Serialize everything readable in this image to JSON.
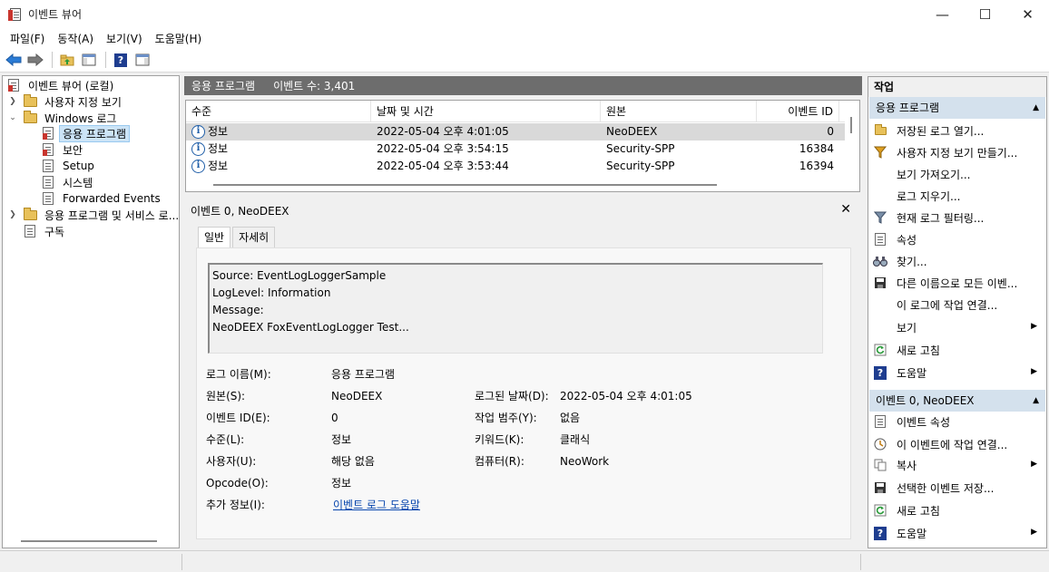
{
  "window": {
    "title": "이벤트 뷰어",
    "minimize": "—",
    "maximize": "☐",
    "close": "✕"
  },
  "menu": [
    "파일(F)",
    "동작(A)",
    "보기(V)",
    "도움말(H)"
  ],
  "tree": {
    "root": "이벤트 뷰어 (로컬)",
    "custom_views": "사용자 지정 보기",
    "windows_logs": "Windows 로그",
    "logs": [
      "응용 프로그램",
      "보안",
      "Setup",
      "시스템",
      "Forwarded Events"
    ],
    "app_services": "응용 프로그램 및 서비스 로...",
    "subscriptions": "구독"
  },
  "list": {
    "header_title": "응용 프로그램",
    "event_count": "이벤트 수: 3,401",
    "columns": [
      "수준",
      "날짜 및 시간",
      "원본",
      "이벤트 ID"
    ],
    "rows": [
      {
        "level": "정보",
        "datetime": "2022-05-04 오후 4:01:05",
        "source": "NeoDEEX",
        "id": "0"
      },
      {
        "level": "정보",
        "datetime": "2022-05-04 오후 3:54:15",
        "source": "Security-SPP",
        "id": "16384"
      },
      {
        "level": "정보",
        "datetime": "2022-05-04 오후 3:53:44",
        "source": "Security-SPP",
        "id": "16394"
      }
    ]
  },
  "detail": {
    "title": "이벤트 0, NeoDEEX",
    "close": "✕",
    "tabs": [
      "일반",
      "자세히"
    ],
    "message_lines": [
      "Source: EventLogLoggerSample",
      "LogLevel: Information",
      "Message:",
      "NeoDEEX FoxEventLogLogger Test..."
    ],
    "labels": {
      "log_name": "로그 이름(M):",
      "source": "원본(S):",
      "event_id": "이벤트 ID(E):",
      "level": "수준(L):",
      "user": "사용자(U):",
      "opcode": "Opcode(O):",
      "more_info": "추가 정보(I):",
      "logged": "로그된 날짜(D):",
      "task_category": "작업 범주(Y):",
      "keywords": "키워드(K):",
      "computer": "컴퓨터(R):"
    },
    "values": {
      "log_name": "응용 프로그램",
      "source": "NeoDEEX",
      "event_id": "0",
      "level": "정보",
      "user": "해당 없음",
      "opcode": "정보",
      "more_info": "이벤트 로그 도움말",
      "logged": "2022-05-04 오후 4:01:05",
      "task_category": "없음",
      "keywords": "클래식",
      "computer": "NeoWork"
    }
  },
  "actions": {
    "title": "작업",
    "section1": "응용 프로그램",
    "items1": [
      {
        "label": "저장된 로그 열기...",
        "icon": "folder-open-icon"
      },
      {
        "label": "사용자 지정 보기 만들기...",
        "icon": "filter-icon"
      },
      {
        "label": "보기 가져오기...",
        "icon": ""
      },
      {
        "label": "로그 지우기...",
        "icon": ""
      },
      {
        "label": "현재 로그 필터링...",
        "icon": "filter-icon"
      },
      {
        "label": "속성",
        "icon": "properties-icon"
      },
      {
        "label": "찾기...",
        "icon": "binoculars-icon"
      },
      {
        "label": "다른 이름으로 모든 이벤...",
        "icon": "save-icon"
      },
      {
        "label": "이 로그에 작업 연결...",
        "icon": ""
      },
      {
        "label": "보기",
        "icon": "",
        "submenu": true
      },
      {
        "label": "새로 고침",
        "icon": "refresh-icon"
      },
      {
        "label": "도움말",
        "icon": "help-icon",
        "submenu": true
      }
    ],
    "section2": "이벤트 0, NeoDEEX",
    "items2": [
      {
        "label": "이벤트 속성",
        "icon": "properties-icon"
      },
      {
        "label": "이 이벤트에 작업 연결...",
        "icon": "task-icon"
      },
      {
        "label": "복사",
        "icon": "copy-icon",
        "submenu": true
      },
      {
        "label": "선택한 이벤트 저장...",
        "icon": "save-icon"
      },
      {
        "label": "새로 고침",
        "icon": "refresh-icon"
      },
      {
        "label": "도움말",
        "icon": "help-icon",
        "submenu": true
      }
    ]
  }
}
